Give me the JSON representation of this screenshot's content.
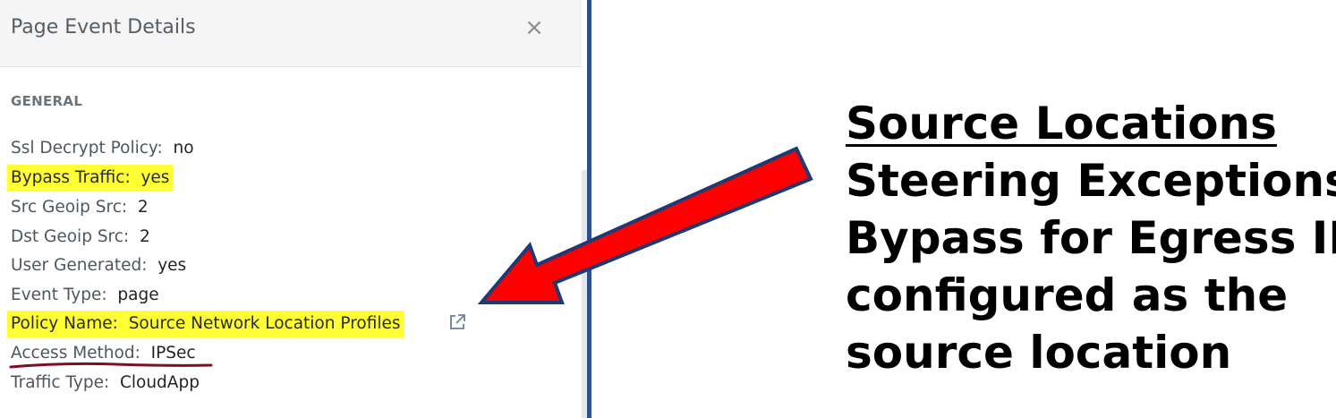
{
  "panel": {
    "title": "Page Event Details",
    "close_glyph": "×",
    "section": "GENERAL",
    "rows": [
      {
        "key": "Ssl Decrypt Policy:",
        "value": "no"
      },
      {
        "key": "Bypass Traffic:",
        "value": "yes"
      },
      {
        "key": "Src Geoip Src:",
        "value": "2"
      },
      {
        "key": "Dst Geoip Src:",
        "value": "2"
      },
      {
        "key": "User Generated:",
        "value": "yes"
      },
      {
        "key": "Event Type:",
        "value": "page"
      },
      {
        "key": "Policy Name:",
        "value": "Source Network Location Profiles"
      },
      {
        "key": "Access Method:",
        "value": "IPSec"
      },
      {
        "key": "Traffic Type:",
        "value": "CloudApp"
      }
    ]
  },
  "callout": {
    "heading": "Source Locations",
    "lines": [
      "Steering Exceptions",
      "Bypass for Egress IP",
      "configured as the",
      "source location"
    ]
  },
  "colors": {
    "highlight": "#ffff33",
    "arrow_fill": "#ff0000",
    "arrow_outline": "#1f3a73",
    "divider": "#2e4f94",
    "underline_mark": "#7a1020"
  },
  "icons": [
    "close-icon",
    "external-link-icon",
    "red-arrow-icon"
  ]
}
